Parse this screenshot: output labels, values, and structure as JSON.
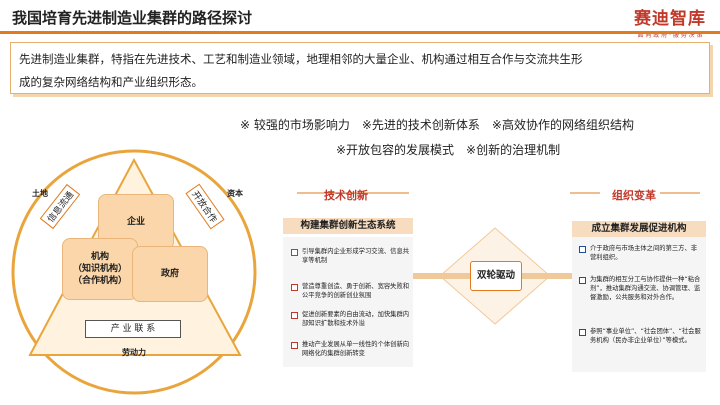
{
  "header": {
    "title": "我国培育先进制造业集群的路径探讨",
    "brand_name": "赛迪智库",
    "brand_tagline": "面 向 政 府 · 服 务 决 策"
  },
  "intro": {
    "line1": "先进制造业集群，特指在先进技术、工艺和制造业领域，地理相邻的大量企业、机构通过相互合作与交流共生形",
    "line2": "成的复杂网络结构和产业组织形态。"
  },
  "features": {
    "line1": "※ 较强的市场影响力　※先进的技术创新体系　※高效协作的网络组织结构",
    "line2": "※开放包容的发展模式　※创新的治理机制"
  },
  "diagram": {
    "land": "土地",
    "capital": "资本",
    "labor": "劳动力",
    "tilt_left": "信息流通",
    "tilt_right": "开放合作",
    "enterprise": "企业",
    "institution_title": "机构",
    "institution_l1": "（知识机构）",
    "institution_l2": "（合作机构）",
    "government": "政府",
    "chain": "产 业 联 系"
  },
  "tech": {
    "heading": "技术创新",
    "panel_title": "构建集群创新生态系统",
    "items": [
      "引导集群内企业形成学习交流、信息共享等机制",
      "营造尊重创造、勇于创新、宽容失败和公平竞争的创新创业氛围",
      "促进创新要素的自由流动，加快集群内部知识扩散和技术外溢",
      "推动产业发展从单一线性的个体创新向网络化的集群创新转变"
    ]
  },
  "org": {
    "heading": "组织变革",
    "panel_title": "成立集群发展促进机构",
    "items": [
      "介于政府与市场主体之间的第三方、非营利组织。",
      "为集群的相互分工与协作提供一种“粘合剂”，推动集群沟通交流、协调管理、监督激励，公共服务和对外合作。",
      "参照“事业单位”、“社会团体”、“社会服务机构（民办非企业单位）”等模式。"
    ]
  },
  "hub": {
    "label": "双轮驱动"
  },
  "colors": {
    "accent": "#e07b1f",
    "brand": "#c0392b",
    "box_fill": "#fad6aa",
    "bullet_blue": "#1f4e9c"
  }
}
